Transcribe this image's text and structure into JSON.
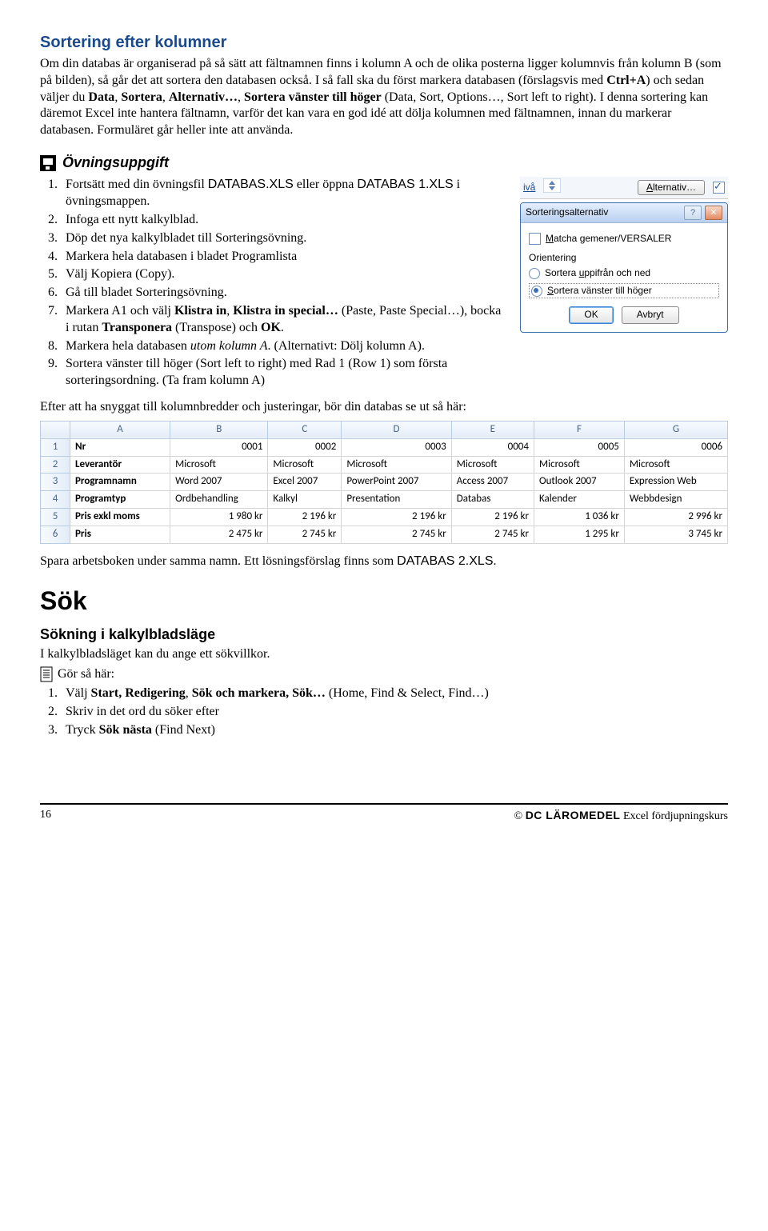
{
  "h_sort": "Sortering efter kolumner",
  "p_sort": "Om din databas är organiserad på så sätt att fältnamnen finns i kolumn A och de olika posterna ligger kolumnvis från kolumn B (som på bilden), så går det att sortera den databasen också. I så fall ska du först markera databasen (förslagsvis med ",
  "p_sort_b1": "Ctrl+A",
  "p_sort_2": ") och sedan väljer du ",
  "p_sort_b2": "Data",
  "p_sort_3": ", ",
  "p_sort_b3": "Sortera",
  "p_sort_4": ", ",
  "p_sort_b4": "Alternativ…",
  "p_sort_5": ", ",
  "p_sort_b5": "Sortera vänster till höger",
  "p_sort_6": " (Data, Sort, Options…, Sort left to right). I denna sortering kan däremot Excel inte hantera fältnamn, varför det kan vara en god idé att dölja kolumnen med fältnamnen, innan du markerar databasen. Formuläret går heller inte att använda.",
  "ovning": "Övningsuppgift",
  "li1a": "Fortsätt med din övningsfil ",
  "li1b": "DATABAS.XLS",
  "li1c": " eller öppna ",
  "li1d": "DATABAS 1.XLS",
  "li1e": " i övningsmappen.",
  "li2": "Infoga ett nytt kalkylblad.",
  "li3": "Döp det nya kalkylbladet till Sorteringsövning.",
  "li4": "Markera hela databasen i bladet Programlista",
  "li5": "Välj Kopiera (Copy).",
  "li6": "Gå till bladet Sorteringsövning.",
  "li7a": "Markera A1 och välj ",
  "li7b": "Klistra in",
  "li7c": ", ",
  "li7d": "Klistra in special…",
  "li7e": " (Paste, Paste Special…), bocka i rutan ",
  "li7f": "Transponera",
  "li7g": " (Transpose) och ",
  "li7h": "OK",
  "li7i": ".",
  "li8a": "Markera hela databasen ",
  "li8b": "utom kolumn A",
  "li8c": ". (Alternativt: Dölj kolumn A).",
  "li9": "Sortera vänster till höger (Sort left to right) med Rad 1 (Row 1) som första sorteringsordning. (Ta fram kolumn A)",
  "dlg_top_iva": "ivå",
  "dlg_top_alt": "Alternativ…",
  "dlg_title": "Sorteringsalternativ",
  "dlg_match": "Matcha gemener/VERSALER",
  "dlg_orient": "Orientering",
  "dlg_r1": "Sortera uppifrån och ned",
  "dlg_r2": "Sortera vänster till höger",
  "dlg_r1_u1": "u",
  "dlg_r2_u1": "S",
  "dlg_match_u": "M",
  "dlg_alt_u": "A",
  "dlg_ok": "OK",
  "dlg_cancel": "Avbryt",
  "p_after": "Efter att ha snyggat till kolumnbredder och justeringar, bör din databas se ut så här:",
  "sheet": {
    "cols": [
      "",
      "A",
      "B",
      "C",
      "D",
      "E",
      "F",
      "G"
    ],
    "rows": [
      [
        "1",
        "Nr",
        "0001",
        "0002",
        "0003",
        "0004",
        "0005",
        "0006"
      ],
      [
        "2",
        "Leverantör",
        "Microsoft",
        "Microsoft",
        "Microsoft",
        "Microsoft",
        "Microsoft",
        "Microsoft"
      ],
      [
        "3",
        "Programnamn",
        "Word 2007",
        "Excel 2007",
        "PowerPoint 2007",
        "Access 2007",
        "Outlook 2007",
        "Expression Web"
      ],
      [
        "4",
        "Programtyp",
        "Ordbehandling",
        "Kalkyl",
        "Presentation",
        "Databas",
        "Kalender",
        "Webbdesign"
      ],
      [
        "5",
        "Pris exkl moms",
        "1 980 kr",
        "2 196 kr",
        "2 196 kr",
        "2 196 kr",
        "1 036 kr",
        "2 996 kr"
      ],
      [
        "6",
        "Pris",
        "2 475 kr",
        "2 745 kr",
        "2 745 kr",
        "2 745 kr",
        "1 295 kr",
        "3 745 kr"
      ]
    ]
  },
  "p_save_a": "Spara arbetsboken under samma namn. Ett lösningsförslag finns som ",
  "p_save_b": "DATABAS 2.XLS",
  "p_save_c": ".",
  "h_sok": "Sök",
  "h_sok_sub": "Sökning i kalkylbladsläge",
  "p_sok": "I kalkylbladsläget kan du ange ett sökvillkor.",
  "gor": "Gör så här:",
  "s1a": "Välj ",
  "s1b": "Start, Redigering",
  "s1c": ", ",
  "s1d": "Sök och markera,  Sök…",
  "s1e": " (Home, Find & Select, Find…)",
  "s2": "Skriv in det ord du söker efter",
  "s3": "Tryck ",
  "s3b": "Sök nästa",
  "s3c": " (Find Next)",
  "footer_page": "16",
  "footer_c": "©",
  "footer_dc": "DC  LÄROMEDEL",
  "footer_txt": "  Excel fördjupningskurs",
  "chart_data": {
    "type": "table",
    "title": "Transposed product database",
    "columns": [
      "Nr",
      "Leverantör",
      "Programnamn",
      "Programtyp",
      "Pris exkl moms",
      "Pris"
    ],
    "series": [
      {
        "name": "0001",
        "values": [
          "0001",
          "Microsoft",
          "Word 2007",
          "Ordbehandling",
          1980,
          2475
        ]
      },
      {
        "name": "0002",
        "values": [
          "0002",
          "Microsoft",
          "Excel 2007",
          "Kalkyl",
          2196,
          2745
        ]
      },
      {
        "name": "0003",
        "values": [
          "0003",
          "Microsoft",
          "PowerPoint 2007",
          "Presentation",
          2196,
          2745
        ]
      },
      {
        "name": "0004",
        "values": [
          "0004",
          "Microsoft",
          "Access 2007",
          "Databas",
          2196,
          2745
        ]
      },
      {
        "name": "0005",
        "values": [
          "0005",
          "Microsoft",
          "Outlook 2007",
          "Kalender",
          1036,
          1295
        ]
      },
      {
        "name": "0006",
        "values": [
          "0006",
          "Microsoft",
          "Expression Web",
          "Webbdesign",
          2996,
          3745
        ]
      }
    ],
    "currency": "kr"
  }
}
